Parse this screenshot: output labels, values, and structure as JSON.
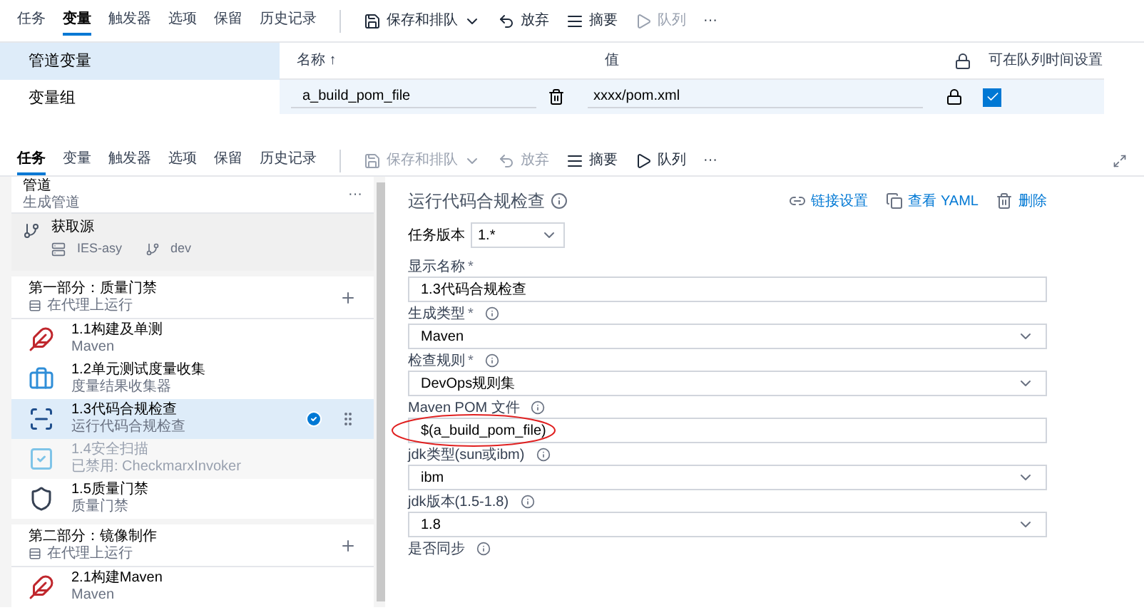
{
  "variables_page": {
    "tabs": [
      {
        "label": "任务",
        "selected": false
      },
      {
        "label": "变量",
        "selected": true
      },
      {
        "label": "触发器",
        "selected": false
      },
      {
        "label": "选项",
        "selected": false
      },
      {
        "label": "保留",
        "selected": false
      },
      {
        "label": "历史记录",
        "selected": false
      }
    ],
    "toolbar": [
      {
        "kind": "save",
        "label": "保存和排队",
        "disabled": false,
        "menu": true
      },
      {
        "kind": "discard",
        "label": "放弃",
        "disabled": false,
        "menu": false
      },
      {
        "kind": "summary",
        "label": "摘要",
        "disabled": false,
        "menu": false
      },
      {
        "kind": "queue",
        "label": "队列",
        "disabled": true,
        "menu": false
      },
      {
        "kind": "more",
        "label": "···",
        "disabled": false,
        "menu": false
      }
    ],
    "nav": [
      {
        "label": "管道变量",
        "selected": true
      },
      {
        "label": "变量组",
        "selected": false
      }
    ],
    "table": {
      "columns": [
        "名称 ↑",
        "值",
        "可在队列时间设置"
      ],
      "rows": [
        {
          "name": "a_build_pom_file",
          "value": "xxxx/pom.xml",
          "settable": true
        }
      ]
    }
  },
  "task_page": {
    "tabs": [
      {
        "label": "任务",
        "selected": true
      },
      {
        "label": "变量",
        "selected": false
      },
      {
        "label": "触发器",
        "selected": false
      },
      {
        "label": "选项",
        "selected": false
      },
      {
        "label": "保留",
        "selected": false
      },
      {
        "label": "历史记录",
        "selected": false
      }
    ],
    "toolbar": [
      {
        "kind": "save",
        "label": "保存和排队",
        "disabled": true,
        "menu": true
      },
      {
        "kind": "discard",
        "label": "放弃",
        "disabled": true,
        "menu": false
      },
      {
        "kind": "summary",
        "label": "摘要",
        "disabled": false,
        "menu": false
      },
      {
        "kind": "queue",
        "label": "队列",
        "disabled": false,
        "menu": false
      },
      {
        "kind": "more",
        "label": "···",
        "disabled": false,
        "menu": false
      }
    ],
    "pipeline": {
      "title": "管道",
      "subtitle": "生成管道",
      "menu": "···"
    },
    "items": [
      {
        "kind": "source",
        "title": "获取源",
        "repo": "IES-asy",
        "branch": "dev"
      },
      {
        "kind": "phase",
        "title": "第一部分：质量门禁",
        "subtitle": "在代理上运行"
      },
      {
        "kind": "task",
        "title": "1.1构建及单测",
        "subtitle": "Maven",
        "selected": false,
        "disabled": false
      },
      {
        "kind": "task",
        "title": "1.2单元测试度量收集",
        "subtitle": "度量结果收集器",
        "selected": false,
        "disabled": false
      },
      {
        "kind": "task",
        "title": "1.3代码合规检查",
        "subtitle": "运行代码合规检查",
        "selected": true,
        "disabled": false
      },
      {
        "kind": "task",
        "title": "1.4安全扫描",
        "subtitle": "已禁用: CheckmarxInvoker",
        "selected": false,
        "disabled": true
      },
      {
        "kind": "task",
        "title": "1.5质量门禁",
        "subtitle": "质量门禁",
        "selected": false,
        "disabled": false
      },
      {
        "kind": "phase",
        "title": "第二部分：镜像制作",
        "subtitle": "在代理上运行"
      },
      {
        "kind": "task",
        "title": "2.1构建Maven",
        "subtitle": "Maven",
        "selected": false,
        "disabled": false
      }
    ],
    "detail": {
      "title": "运行代码合规检查",
      "actions": [
        {
          "kind": "link",
          "label": "链接设置"
        },
        {
          "kind": "yaml",
          "label": "查看 YAML"
        },
        {
          "kind": "delete",
          "label": "删除"
        }
      ],
      "version_label": "任务版本",
      "version": "1.*",
      "fields": [
        {
          "kind": "text",
          "label": "显示名称",
          "required": "*",
          "value": "1.3代码合规检查"
        },
        {
          "kind": "select",
          "label": "生成类型",
          "required": "*",
          "info": true,
          "value": "Maven"
        },
        {
          "kind": "select",
          "label": "检查规则",
          "required": "*",
          "info": true,
          "value": "DevOps规则集"
        },
        {
          "kind": "text",
          "label": "Maven POM 文件",
          "info": true,
          "value": "$(a_build_pom_file)",
          "circled": true
        },
        {
          "kind": "select",
          "label": "jdk类型(sun或ibm)",
          "info": true,
          "value": "ibm"
        },
        {
          "kind": "select",
          "label": "jdk版本(1.5-1.8)",
          "info": true,
          "value": "1.8"
        },
        {
          "kind": "label",
          "label": "是否同步",
          "info": true
        }
      ]
    }
  }
}
